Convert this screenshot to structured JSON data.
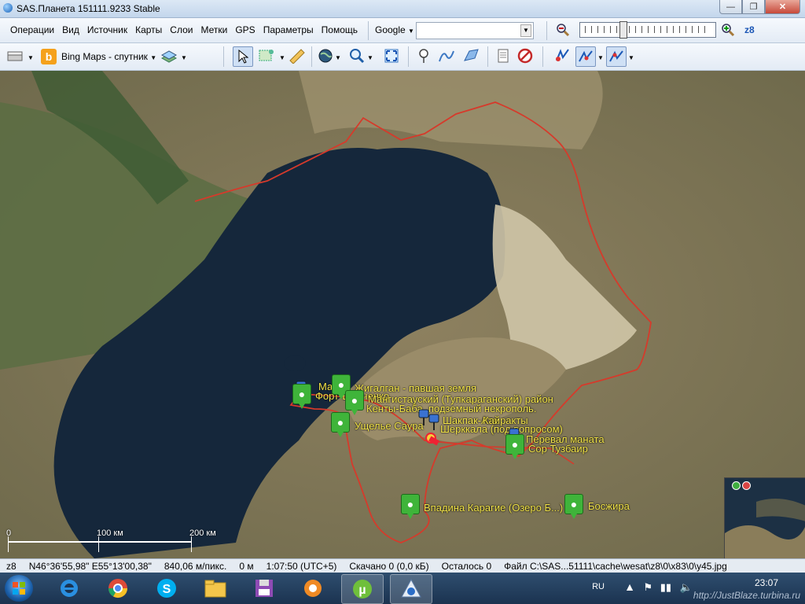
{
  "window": {
    "title": "SAS.Планета 151111.9233 Stable"
  },
  "menu": [
    "Операции",
    "Вид",
    "Источник",
    "Карты",
    "Слои",
    "Метки",
    "GPS",
    "Параметры",
    "Помощь"
  ],
  "search": {
    "provider": "Google",
    "value": ""
  },
  "zoom": {
    "label": "z8",
    "level": 8
  },
  "toolbar": {
    "map_source": "Bing Maps - спутник"
  },
  "placemarks": [
    {
      "name": "Маяк",
      "type": "pin"
    },
    {
      "name": "Жигалган - павшая земля",
      "type": "pin"
    },
    {
      "name": "Форт-Шевченко",
      "type": "green"
    },
    {
      "name": "Мангистауский (Тупкараганский) район",
      "type": "label"
    },
    {
      "name": "Кенты-Баба, подземный некрополь.",
      "type": "green"
    },
    {
      "name": "Ущелье Саура",
      "type": "green"
    },
    {
      "name": "Шакпак-Ата",
      "type": "pin"
    },
    {
      "name": "Кайракты",
      "type": "label"
    },
    {
      "name": "Шерккала (под вопросом)",
      "type": "label"
    },
    {
      "name": "Перевал маната",
      "type": "pin"
    },
    {
      "name": "Сор Тузбаир",
      "type": "green"
    },
    {
      "name": "Впадина Карагие (Озеро Б...)",
      "type": "green"
    },
    {
      "name": "Босжира",
      "type": "green"
    }
  ],
  "scale": {
    "ticks": [
      "0",
      "100 км",
      "200 км"
    ]
  },
  "status": {
    "zoom": "z8",
    "coords": "N46°36'55,98\" E55°13'00,38\"",
    "resolution": "840,06 м/пикс.",
    "distance": "0 м",
    "time": "1:07:50 (UTC+5)",
    "downloaded": "Скачано 0 (0,0 кБ)",
    "remaining": "Осталось 0",
    "file": "Файл C:\\SAS...51111\\cache\\wesat\\z8\\0\\x83\\0\\y45.jpg"
  },
  "taskbar": {
    "lang": "RU",
    "clock": "23:07",
    "watermark": "http://JustBlaze.turbina.ru"
  }
}
